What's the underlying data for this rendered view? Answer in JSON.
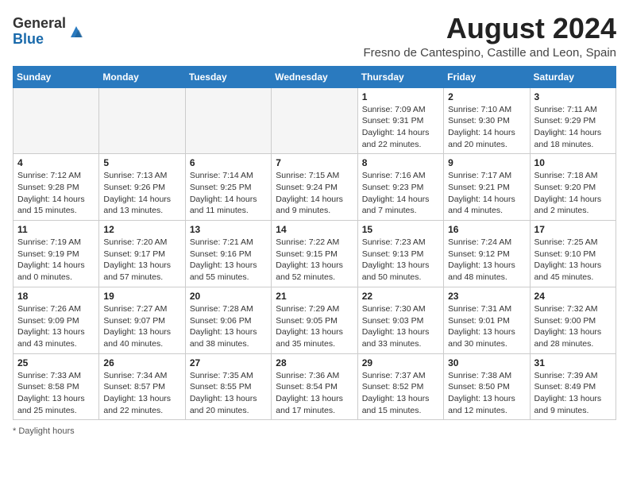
{
  "logo": {
    "general": "General",
    "blue": "Blue"
  },
  "title": "August 2024",
  "subtitle": "Fresno de Cantespino, Castille and Leon, Spain",
  "headers": [
    "Sunday",
    "Monday",
    "Tuesday",
    "Wednesday",
    "Thursday",
    "Friday",
    "Saturday"
  ],
  "footer": "Daylight hours",
  "weeks": [
    [
      {
        "day": "",
        "info": ""
      },
      {
        "day": "",
        "info": ""
      },
      {
        "day": "",
        "info": ""
      },
      {
        "day": "",
        "info": ""
      },
      {
        "day": "1",
        "info": "Sunrise: 7:09 AM\nSunset: 9:31 PM\nDaylight: 14 hours and 22 minutes."
      },
      {
        "day": "2",
        "info": "Sunrise: 7:10 AM\nSunset: 9:30 PM\nDaylight: 14 hours and 20 minutes."
      },
      {
        "day": "3",
        "info": "Sunrise: 7:11 AM\nSunset: 9:29 PM\nDaylight: 14 hours and 18 minutes."
      }
    ],
    [
      {
        "day": "4",
        "info": "Sunrise: 7:12 AM\nSunset: 9:28 PM\nDaylight: 14 hours and 15 minutes."
      },
      {
        "day": "5",
        "info": "Sunrise: 7:13 AM\nSunset: 9:26 PM\nDaylight: 14 hours and 13 minutes."
      },
      {
        "day": "6",
        "info": "Sunrise: 7:14 AM\nSunset: 9:25 PM\nDaylight: 14 hours and 11 minutes."
      },
      {
        "day": "7",
        "info": "Sunrise: 7:15 AM\nSunset: 9:24 PM\nDaylight: 14 hours and 9 minutes."
      },
      {
        "day": "8",
        "info": "Sunrise: 7:16 AM\nSunset: 9:23 PM\nDaylight: 14 hours and 7 minutes."
      },
      {
        "day": "9",
        "info": "Sunrise: 7:17 AM\nSunset: 9:21 PM\nDaylight: 14 hours and 4 minutes."
      },
      {
        "day": "10",
        "info": "Sunrise: 7:18 AM\nSunset: 9:20 PM\nDaylight: 14 hours and 2 minutes."
      }
    ],
    [
      {
        "day": "11",
        "info": "Sunrise: 7:19 AM\nSunset: 9:19 PM\nDaylight: 14 hours and 0 minutes."
      },
      {
        "day": "12",
        "info": "Sunrise: 7:20 AM\nSunset: 9:17 PM\nDaylight: 13 hours and 57 minutes."
      },
      {
        "day": "13",
        "info": "Sunrise: 7:21 AM\nSunset: 9:16 PM\nDaylight: 13 hours and 55 minutes."
      },
      {
        "day": "14",
        "info": "Sunrise: 7:22 AM\nSunset: 9:15 PM\nDaylight: 13 hours and 52 minutes."
      },
      {
        "day": "15",
        "info": "Sunrise: 7:23 AM\nSunset: 9:13 PM\nDaylight: 13 hours and 50 minutes."
      },
      {
        "day": "16",
        "info": "Sunrise: 7:24 AM\nSunset: 9:12 PM\nDaylight: 13 hours and 48 minutes."
      },
      {
        "day": "17",
        "info": "Sunrise: 7:25 AM\nSunset: 9:10 PM\nDaylight: 13 hours and 45 minutes."
      }
    ],
    [
      {
        "day": "18",
        "info": "Sunrise: 7:26 AM\nSunset: 9:09 PM\nDaylight: 13 hours and 43 minutes."
      },
      {
        "day": "19",
        "info": "Sunrise: 7:27 AM\nSunset: 9:07 PM\nDaylight: 13 hours and 40 minutes."
      },
      {
        "day": "20",
        "info": "Sunrise: 7:28 AM\nSunset: 9:06 PM\nDaylight: 13 hours and 38 minutes."
      },
      {
        "day": "21",
        "info": "Sunrise: 7:29 AM\nSunset: 9:05 PM\nDaylight: 13 hours and 35 minutes."
      },
      {
        "day": "22",
        "info": "Sunrise: 7:30 AM\nSunset: 9:03 PM\nDaylight: 13 hours and 33 minutes."
      },
      {
        "day": "23",
        "info": "Sunrise: 7:31 AM\nSunset: 9:01 PM\nDaylight: 13 hours and 30 minutes."
      },
      {
        "day": "24",
        "info": "Sunrise: 7:32 AM\nSunset: 9:00 PM\nDaylight: 13 hours and 28 minutes."
      }
    ],
    [
      {
        "day": "25",
        "info": "Sunrise: 7:33 AM\nSunset: 8:58 PM\nDaylight: 13 hours and 25 minutes."
      },
      {
        "day": "26",
        "info": "Sunrise: 7:34 AM\nSunset: 8:57 PM\nDaylight: 13 hours and 22 minutes."
      },
      {
        "day": "27",
        "info": "Sunrise: 7:35 AM\nSunset: 8:55 PM\nDaylight: 13 hours and 20 minutes."
      },
      {
        "day": "28",
        "info": "Sunrise: 7:36 AM\nSunset: 8:54 PM\nDaylight: 13 hours and 17 minutes."
      },
      {
        "day": "29",
        "info": "Sunrise: 7:37 AM\nSunset: 8:52 PM\nDaylight: 13 hours and 15 minutes."
      },
      {
        "day": "30",
        "info": "Sunrise: 7:38 AM\nSunset: 8:50 PM\nDaylight: 13 hours and 12 minutes."
      },
      {
        "day": "31",
        "info": "Sunrise: 7:39 AM\nSunset: 8:49 PM\nDaylight: 13 hours and 9 minutes."
      }
    ]
  ]
}
